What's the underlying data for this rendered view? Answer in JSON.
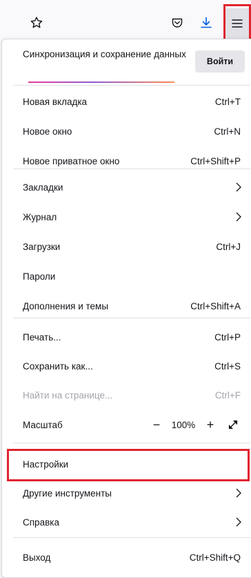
{
  "toolbar": {
    "icons": [
      "star-icon",
      "pocket-icon",
      "download-icon",
      "hamburger-menu-icon"
    ],
    "accent": "#0060df"
  },
  "sync": {
    "text": "Синхронизация и сохранение данных",
    "button": "Войти"
  },
  "menu": {
    "new_tab": {
      "label": "Новая вкладка",
      "shortcut": "Ctrl+T"
    },
    "new_window": {
      "label": "Новое окно",
      "shortcut": "Ctrl+N"
    },
    "new_private_window": {
      "label": "Новое приватное окно",
      "shortcut": "Ctrl+Shift+P"
    },
    "bookmarks": {
      "label": "Закладки"
    },
    "history": {
      "label": "Журнал"
    },
    "downloads": {
      "label": "Загрузки",
      "shortcut": "Ctrl+J"
    },
    "passwords": {
      "label": "Пароли"
    },
    "addons": {
      "label": "Дополнения и темы",
      "shortcut": "Ctrl+Shift+A"
    },
    "print": {
      "label": "Печать...",
      "shortcut": "Ctrl+P"
    },
    "save_as": {
      "label": "Сохранить как...",
      "shortcut": "Ctrl+S"
    },
    "find": {
      "label": "Найти на странице...",
      "shortcut": "Ctrl+F"
    },
    "zoom": {
      "label": "Масштаб",
      "minus": "−",
      "value": "100%",
      "plus": "+"
    },
    "settings": {
      "label": "Настройки"
    },
    "more_tools": {
      "label": "Другие инструменты"
    },
    "help": {
      "label": "Справка"
    },
    "exit": {
      "label": "Выход",
      "shortcut": "Ctrl+Shift+Q"
    }
  },
  "highlight_color": "#e0242e"
}
